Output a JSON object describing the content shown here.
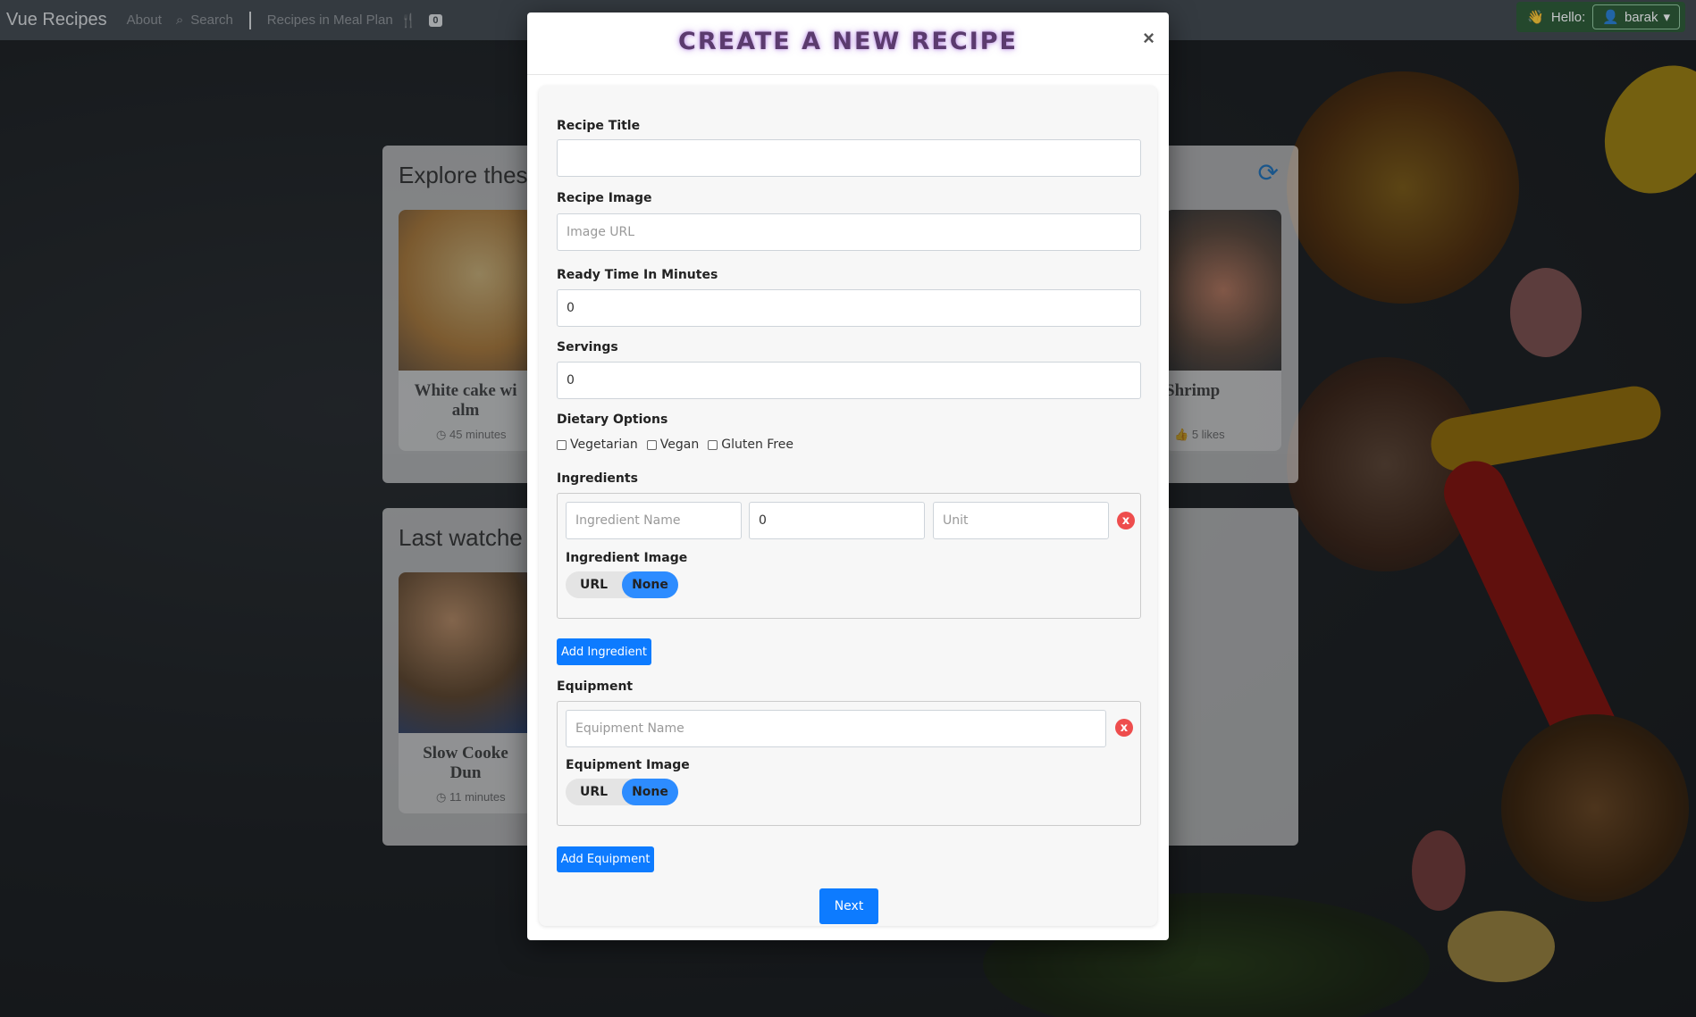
{
  "navbar": {
    "brand": "Vue Recipes",
    "about": "About",
    "search": "Search",
    "meal_plan": "Recipes in Meal Plan",
    "meal_plan_count": "0",
    "hello": "Hello:",
    "user": "barak"
  },
  "background": {
    "explore_title": "Explore thes",
    "last_watched_title": "Last watche",
    "cards": [
      {
        "title_line1": "White cake wi",
        "title_line2": "alm",
        "meta": "45 minutes"
      },
      {
        "title_line1": "Shrimp",
        "meta": "5 likes"
      },
      {
        "title_line1": "Slow Cooke",
        "title_line2": "Dun",
        "meta": "11 minutes"
      }
    ]
  },
  "modal": {
    "title": "CREATE A NEW RECIPE",
    "close": "×",
    "recipe_title_label": "Recipe Title",
    "recipe_title_value": "",
    "recipe_image_label": "Recipe Image",
    "recipe_image_placeholder": "Image URL",
    "ready_time_label": "Ready Time In Minutes",
    "ready_time_value": "0",
    "servings_label": "Servings",
    "servings_value": "0",
    "dietary_label": "Dietary Options",
    "dietary_options": [
      "Vegetarian",
      "Vegan",
      "Gluten Free"
    ],
    "ingredients_label": "Ingredients",
    "ingredient_name_placeholder": "Ingredient Name",
    "ingredient_amount_value": "0",
    "ingredient_unit_placeholder": "Unit",
    "remove_label": "x",
    "ingredient_image_label": "Ingredient Image",
    "toggle_url": "URL",
    "toggle_none": "None",
    "add_ingredient": "Add Ingredient",
    "equipment_label": "Equipment",
    "equipment_name_placeholder": "Equipment Name",
    "equipment_image_label": "Equipment Image",
    "add_equipment": "Add Equipment",
    "next": "Next"
  },
  "colors": {
    "primary": "#0d7bff",
    "toggle_active": "#2d8cff",
    "remove": "#ee4d4d",
    "title_glow": "#5b3b6e"
  }
}
